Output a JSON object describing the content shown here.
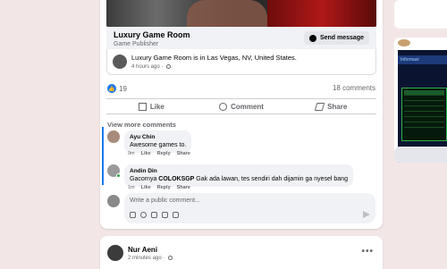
{
  "page_card": {
    "name": "Luxury Game Room",
    "subtitle": "Game Publisher",
    "message_button": "Send message"
  },
  "checkin": {
    "page_link": "Luxury Game Room",
    "is_in": " is in ",
    "location": "Las Vegas, NV, United States",
    "period": ".",
    "time": "4 hours ago · "
  },
  "stats": {
    "likes": "19",
    "comments": "18 comments"
  },
  "actions": {
    "like": "Like",
    "comment": "Comment",
    "share": "Share"
  },
  "view_more": "View more comments",
  "comments": [
    {
      "author": "Ayu Chin",
      "text": "Awesome games to.",
      "time": "9m",
      "like": "Like",
      "reply": "Reply",
      "share": "Share"
    },
    {
      "author": "Andin Din",
      "text_prefix": "Gacornya ",
      "text_bold": "COLOKSGP",
      "text_suffix": " Gak ada lawan, tes sendiri dah dijamin ga nyesel bang",
      "time": "1m",
      "like": "Like",
      "reply": "Reply",
      "share": "Share"
    }
  ],
  "write_comment": {
    "placeholder": "Write a public comment..."
  },
  "next_post": {
    "author": "Nur Aeni",
    "time": "2 minutes ago · ",
    "more": "•••"
  },
  "right_rail": {
    "banner_label": "Informasi"
  },
  "colors": {
    "accent": "#1877f2",
    "background": "#f3e6e6"
  }
}
